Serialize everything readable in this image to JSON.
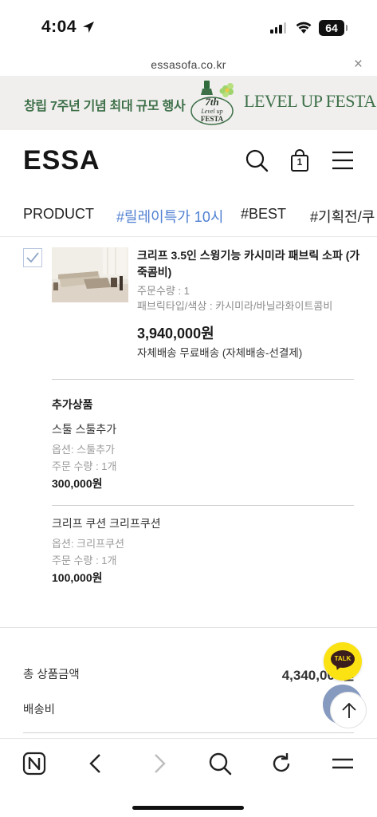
{
  "status_bar": {
    "time": "4:04",
    "battery": "64"
  },
  "browser": {
    "url": "essasofa.co.kr",
    "close_symbol": "×"
  },
  "banner": {
    "text": "창립 7주년 기념 최대 규모 행사",
    "logo_text": [
      "7th",
      "Level up",
      "FESTA"
    ],
    "festa_text": "LEVEL UP FESTA",
    "color": "#3e7048"
  },
  "header": {
    "logo": "ESSA",
    "cart_count": "1"
  },
  "categories": [
    {
      "label": "PRODUCT"
    },
    {
      "label": "#릴레이특가 10시"
    },
    {
      "label": "#BEST"
    },
    {
      "label": "#기획전/쿠"
    }
  ],
  "order_item": {
    "name": "크리프 3.5인 스윙기능 카시미라 패브릭 소파 (가죽콤비)",
    "quantity": "주문수량 : 1",
    "option": "패브릭타입/색상 : 카시미라/바닐라화이트콤비",
    "price": "3,940,000원",
    "shipping": "자체배송 무료배송 (자체배송-선결제)"
  },
  "addons": {
    "title": "추가상품",
    "items": [
      {
        "name": "스툴 스툴추가",
        "option": "옵션: 스툴추가",
        "quantity": "주문 수량 : 1개",
        "price": "300,000원"
      },
      {
        "name": "크리프 쿠션 크리프쿠션",
        "option": "옵션: 크리프쿠션",
        "quantity": "주문 수량 : 1개",
        "price": "100,000원"
      }
    ]
  },
  "summary": {
    "total_label": "총 상품금액",
    "total_value": "4,340,000원",
    "shipping_label": "배송비"
  },
  "floating": {
    "kakao_label": "TALK"
  },
  "colors": {
    "accent": "#4f7fd1",
    "kakao": "#fbe212",
    "banner_green": "#3e7048"
  }
}
